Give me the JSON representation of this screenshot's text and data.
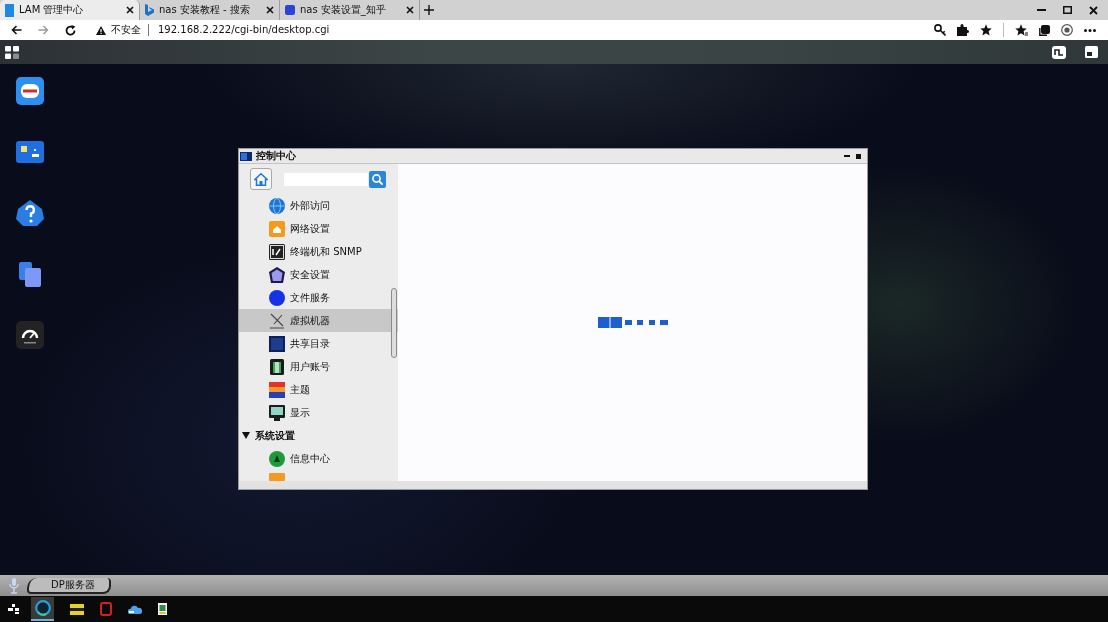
{
  "browser": {
    "tabs": [
      {
        "title": "LAM 管理中心",
        "selected": true
      },
      {
        "title": "nas 安装教程 - 搜索",
        "selected": false
      },
      {
        "title": "nas 安装设置_知乎",
        "selected": false
      }
    ],
    "address_bar": {
      "security_label": "不安全",
      "url": "192.168.2.222/cgi-bin/desktop.cgi"
    }
  },
  "app_window": {
    "title": "控制中心",
    "sidebar": {
      "groups": [
        {
          "items": [
            {
              "kind": "row",
              "label": "外部访问",
              "selected": false
            },
            {
              "kind": "row",
              "label": "网络设置",
              "selected": false
            },
            {
              "kind": "row",
              "label": "终端机和 SNMP",
              "selected": false
            },
            {
              "kind": "row",
              "label": "安全设置",
              "selected": false
            },
            {
              "kind": "row",
              "label": "文件服务",
              "selected": false
            },
            {
              "kind": "row",
              "label": "虚拟机器",
              "selected": true
            },
            {
              "kind": "row",
              "label": "共享目录",
              "selected": false
            },
            {
              "kind": "row",
              "label": "用户账号",
              "selected": false
            },
            {
              "kind": "row",
              "label": "主题",
              "selected": false
            },
            {
              "kind": "row",
              "label": "显示",
              "selected": false
            }
          ]
        },
        {
          "label": "系统设置",
          "expanded": true,
          "items": [
            {
              "kind": "row",
              "label": "信息中心",
              "selected": false
            },
            {
              "kind": "clipped",
              "selected": false
            }
          ]
        }
      ]
    }
  },
  "taskbar": {
    "tab_label": "DP服务器"
  }
}
